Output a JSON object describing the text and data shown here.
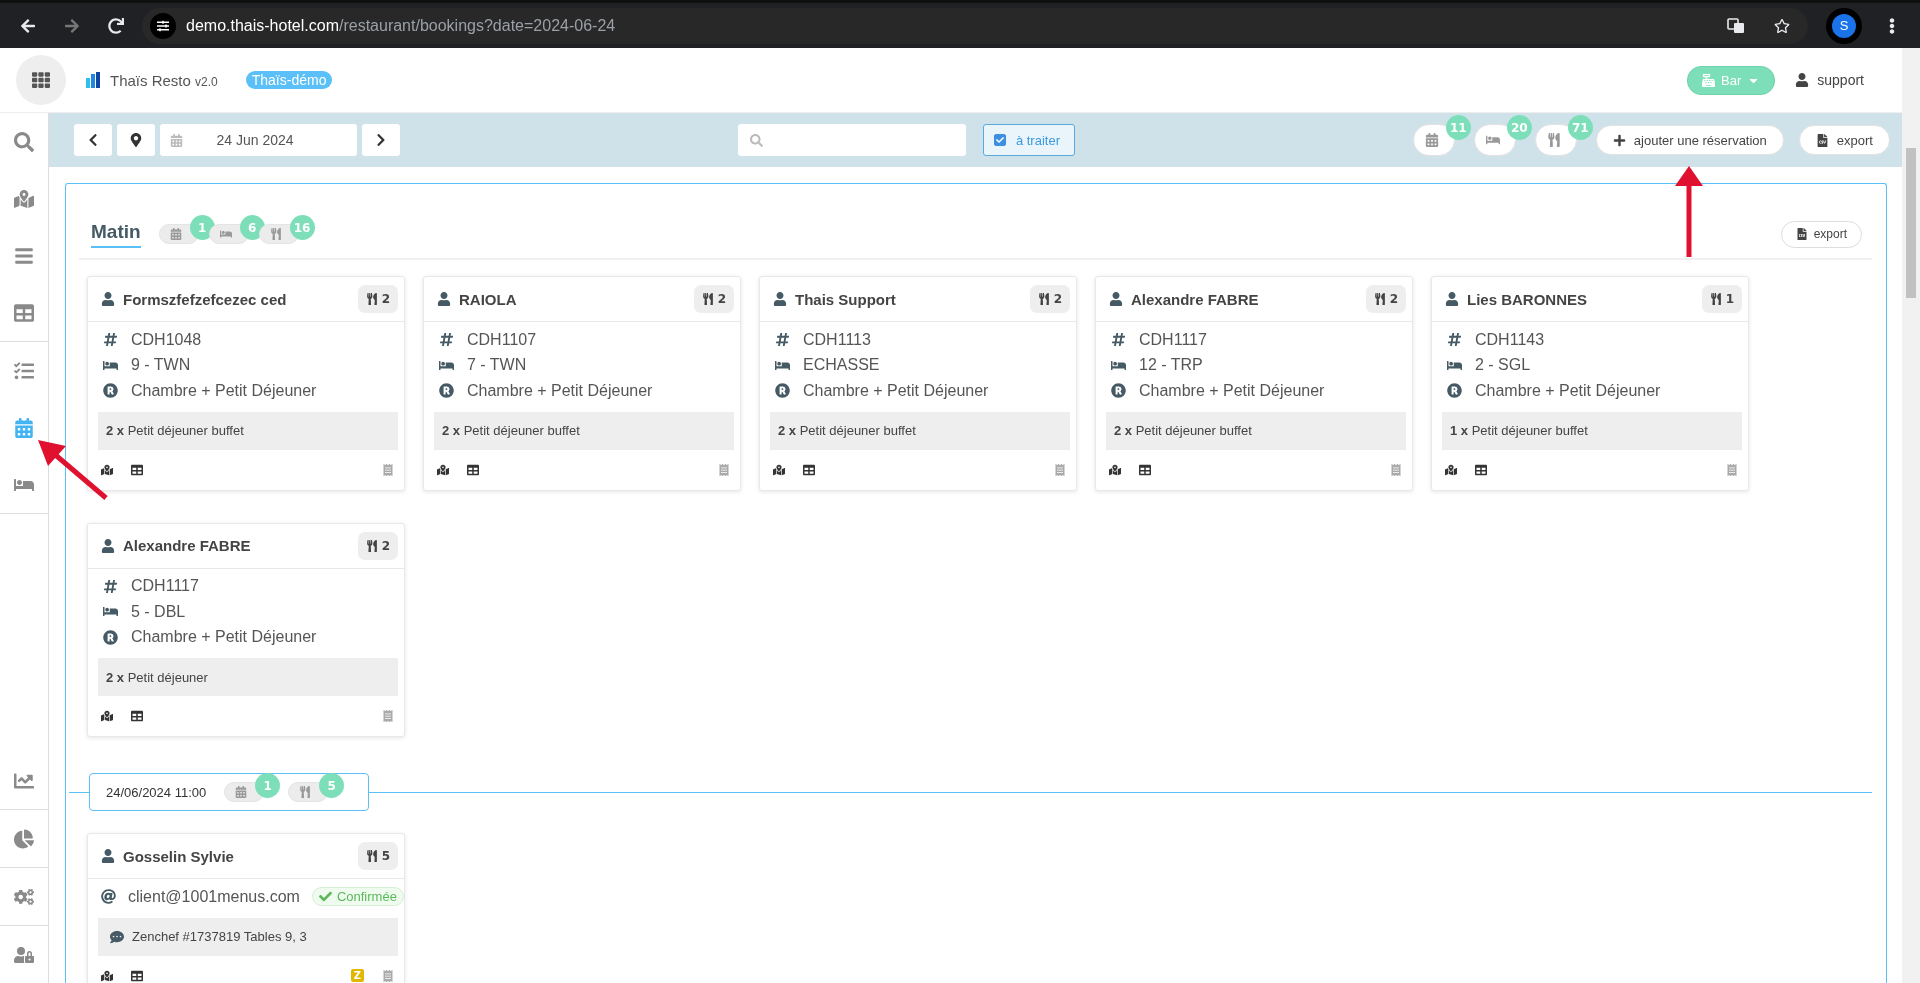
{
  "browser": {
    "url_host": "demo.thais-hotel.com",
    "url_path": "/restaurant/bookings?date=2024-06-24",
    "profile": "S"
  },
  "header": {
    "app_name": "Thaïs Resto",
    "version": "v2.0",
    "badge": "Thaïs-démo",
    "outlet_button": "Bar",
    "user": "support"
  },
  "sidebar": {
    "groups": [
      {
        "items": [
          {
            "selected": false
          },
          {
            "selected": false
          },
          {
            "selected": false
          },
          {
            "selected": false
          }
        ]
      },
      {
        "items": [
          {
            "selected": false
          },
          {
            "selected": true
          },
          {
            "selected": false
          }
        ]
      },
      {
        "items": [
          {
            "selected": false
          }
        ]
      },
      {
        "items": [
          {
            "selected": false
          }
        ]
      },
      {
        "items": [
          {
            "selected": false
          }
        ]
      },
      {
        "items": [
          {
            "selected": false
          }
        ]
      }
    ]
  },
  "toolbar": {
    "date": "24 Jun 2024",
    "filter": {
      "label": "à traiter",
      "checked": true
    },
    "counters": [
      {
        "kind": "calendar",
        "count": "11"
      },
      {
        "kind": "bed",
        "count": "20"
      },
      {
        "kind": "covers",
        "count": "71"
      }
    ],
    "add_button": "ajouter une réservation",
    "export_button": "export"
  },
  "sections": [
    {
      "kind": "tab",
      "title": "Matin",
      "export_button": "export",
      "counters": [
        {
          "kind": "calendar",
          "count": "1"
        },
        {
          "kind": "bed",
          "count": "6"
        },
        {
          "kind": "covers",
          "count": "16"
        }
      ],
      "bookings": [
        {
          "name": "Formszfefzefcezec ced",
          "covers": "2",
          "lines": [
            {
              "kind": "reference",
              "text": "CDH1048"
            },
            {
              "kind": "room",
              "text": "9 - TWN"
            },
            {
              "kind": "rate",
              "text": "Chambre + Petit Déjeuner"
            }
          ],
          "note": {
            "kind": "order",
            "text": "**2 x** Petit déjeuner buffet"
          }
        },
        {
          "name": "RAIOLA",
          "covers": "2",
          "lines": [
            {
              "kind": "reference",
              "text": "CDH1107"
            },
            {
              "kind": "room",
              "text": "7 - TWN"
            },
            {
              "kind": "rate",
              "text": "Chambre + Petit Déjeuner"
            }
          ],
          "note": {
            "kind": "order",
            "text": "**2 x** Petit déjeuner buffet"
          }
        },
        {
          "name": "Thais Support",
          "covers": "2",
          "lines": [
            {
              "kind": "reference",
              "text": "CDH1113"
            },
            {
              "kind": "room",
              "text": "ECHASSE"
            },
            {
              "kind": "rate",
              "text": "Chambre + Petit Déjeuner"
            }
          ],
          "note": {
            "kind": "order",
            "text": "**2 x** Petit déjeuner buffet"
          }
        },
        {
          "name": "Alexandre FABRE",
          "covers": "2",
          "lines": [
            {
              "kind": "reference",
              "text": "CDH1117"
            },
            {
              "kind": "room",
              "text": "12 - TRP"
            },
            {
              "kind": "rate",
              "text": "Chambre + Petit Déjeuner"
            }
          ],
          "note": {
            "kind": "order",
            "text": "**2 x** Petit déjeuner buffet"
          }
        },
        {
          "name": "Lies BARONNES",
          "covers": "1",
          "lines": [
            {
              "kind": "reference",
              "text": "CDH1143"
            },
            {
              "kind": "room",
              "text": "2 - SGL"
            },
            {
              "kind": "rate",
              "text": "Chambre + Petit Déjeuner"
            }
          ],
          "note": {
            "kind": "order",
            "text": "**1 x** Petit déjeuner buffet"
          }
        },
        {
          "name": "Alexandre FABRE",
          "covers": "2",
          "lines": [
            {
              "kind": "reference",
              "text": "CDH1117"
            },
            {
              "kind": "room",
              "text": "5 - DBL"
            },
            {
              "kind": "rate",
              "text": "Chambre + Petit Déjeuner"
            }
          ],
          "note": {
            "kind": "order",
            "text": "**2 x** Petit déjeuner"
          }
        }
      ]
    },
    {
      "kind": "slot",
      "title": "24/06/2024 11:00",
      "counters": [
        {
          "kind": "calendar",
          "count": "1"
        },
        {
          "kind": "covers",
          "count": "5"
        }
      ],
      "bookings": [
        {
          "name": "Gosselin Sylvie",
          "covers": "5",
          "lines": [
            {
              "kind": "email",
              "text": "client@1001menus.com",
              "status": "Confirmée"
            }
          ],
          "note": {
            "kind": "comment",
            "text": "Zenchef #1737819 Tables 9, 3"
          },
          "source_badge": "Z"
        }
      ]
    }
  ]
}
